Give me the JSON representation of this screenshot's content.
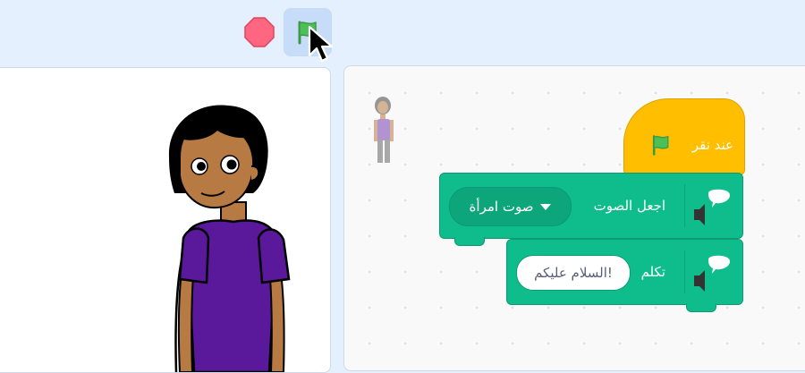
{
  "toolbar": {
    "stop_icon": "stop-sign-icon",
    "green_flag_icon": "green-flag-icon",
    "colors": {
      "stop": "#ff6680",
      "flag": "#4cbf56",
      "flag_bg": "#c6dcf8"
    }
  },
  "stage": {
    "sprite_icon": "girl-character"
  },
  "code": {
    "hat_block": {
      "label": "عند نقر",
      "icon": "green-flag-icon",
      "color": "#ffbf00"
    },
    "set_voice_block": {
      "label": "اجعل الصوت",
      "dropdown_value": "صوت امرأة",
      "icon": "text-to-speech-icon",
      "color": "#0fbd8c"
    },
    "speak_block": {
      "label": "تكلم",
      "input_value": "السلام عليكم!",
      "icon": "text-to-speech-icon",
      "color": "#0fbd8c"
    }
  }
}
